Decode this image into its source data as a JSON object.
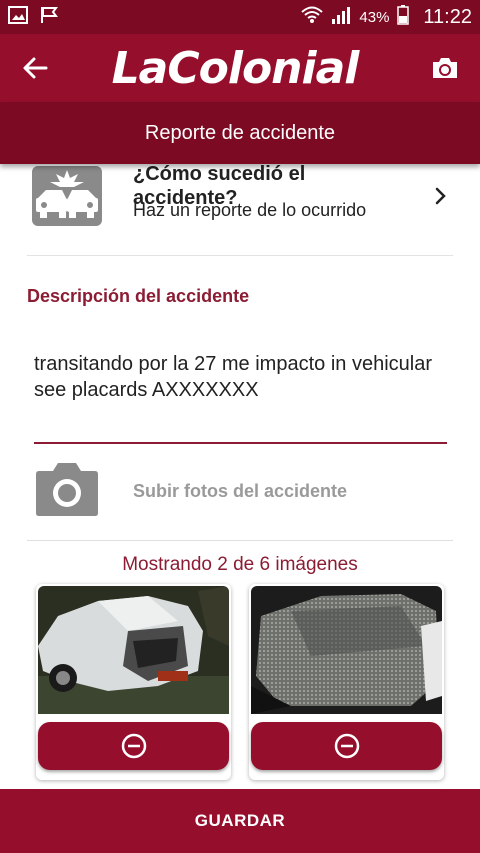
{
  "status_bar": {
    "battery": "43%",
    "time": "11:22"
  },
  "app_bar": {
    "brand": "LaColonial",
    "subtitle": "Reporte de accidente"
  },
  "accident_section": {
    "title_line1": "¿Cómo sucedió el",
    "title_line2": "accidente?",
    "subtitle": "Haz un reporte de lo ocurrido"
  },
  "description": {
    "label": "Descripción del accidente",
    "value": "transitando por la 27 me impacto in vehicular see placards AXXXXXXX"
  },
  "upload": {
    "label": "Subir fotos del accidente"
  },
  "gallery": {
    "status": "Mostrando 2 de 6 imágenes",
    "photos": [
      {
        "alt": "accident-photo-1"
      },
      {
        "alt": "accident-photo-2"
      }
    ]
  },
  "footer": {
    "save_label": "GUARDAR"
  },
  "colors": {
    "primary": "#950f2c",
    "primary_dark": "#7d0a23",
    "accent_text": "#8c1c33"
  }
}
